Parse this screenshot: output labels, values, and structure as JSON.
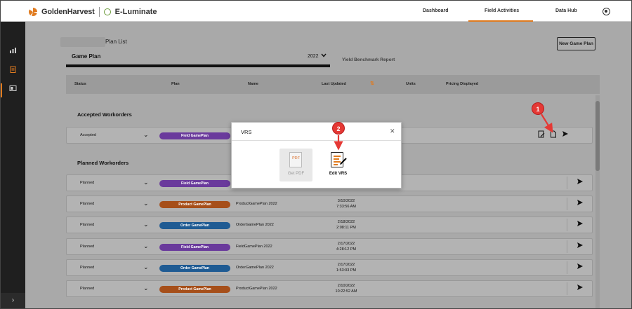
{
  "brand": {
    "name": "GoldenHarvest",
    "product": "E-Luminate"
  },
  "nav": {
    "dashboard": "Dashboard",
    "field_activities": "Field Activities",
    "data_hub": "Data Hub"
  },
  "page": {
    "title": "Plan List",
    "new_plan_button": "New Game Plan",
    "game_plan_label": "Game Plan",
    "year": "2022",
    "yield_tab": "Yield Benchmark Report"
  },
  "table": {
    "headers": {
      "status": "Status",
      "plan": "Plan",
      "name": "Name",
      "last_updated": "Last Updated",
      "units": "Units",
      "pricing": "Pricing Displayed"
    }
  },
  "sections": {
    "accepted": "Accepted Workorders",
    "planned": "Planned Workorders"
  },
  "accepted_rows": [
    {
      "status": "Accepted",
      "plan": "Field GamePlan",
      "name": "",
      "date": "",
      "time": ""
    }
  ],
  "planned_rows": [
    {
      "status": "Planned",
      "plan": "Field GamePlan",
      "name": "",
      "date": "",
      "time": ""
    },
    {
      "status": "Planned",
      "plan": "Product GamePlan",
      "name": "ProductGamePlan 2022",
      "date": "3/10/2022",
      "time": "7:33:56 AM"
    },
    {
      "status": "Planned",
      "plan": "Order GamePlan",
      "name": "OrderGamePlan 2022",
      "date": "2/18/2022",
      "time": "2:08:11 PM"
    },
    {
      "status": "Planned",
      "plan": "Field GamePlan",
      "name": "FieldGamePlan 2022",
      "date": "2/17/2022",
      "time": "4:28:12 PM"
    },
    {
      "status": "Planned",
      "plan": "Order GamePlan",
      "name": "OrderGamePlan 2022",
      "date": "2/17/2022",
      "time": "1:53:03 PM"
    },
    {
      "status": "Planned",
      "plan": "Product GamePlan",
      "name": "ProductGamePlan 2022",
      "date": "2/10/2022",
      "time": "10:22:52 AM"
    }
  ],
  "modal": {
    "title": "VRS",
    "get_pdf_icon_text": "PDF",
    "get_pdf": "Get PDF",
    "edit_vrs": "Edit VRS"
  },
  "callouts": [
    "1",
    "2"
  ],
  "colors": {
    "accent": "#e07b1f",
    "field_pill": "#6a3a9c",
    "product_pill": "#a64f1a",
    "order_pill": "#1f5b93",
    "callout": "#e53935"
  },
  "icons": {
    "sidebar": [
      "bar-chart-icon",
      "clipboard-icon",
      "layout-icon",
      "chevron-right-icon"
    ],
    "row_actions": [
      "edit-doc-icon",
      "document-icon",
      "send-icon"
    ]
  }
}
